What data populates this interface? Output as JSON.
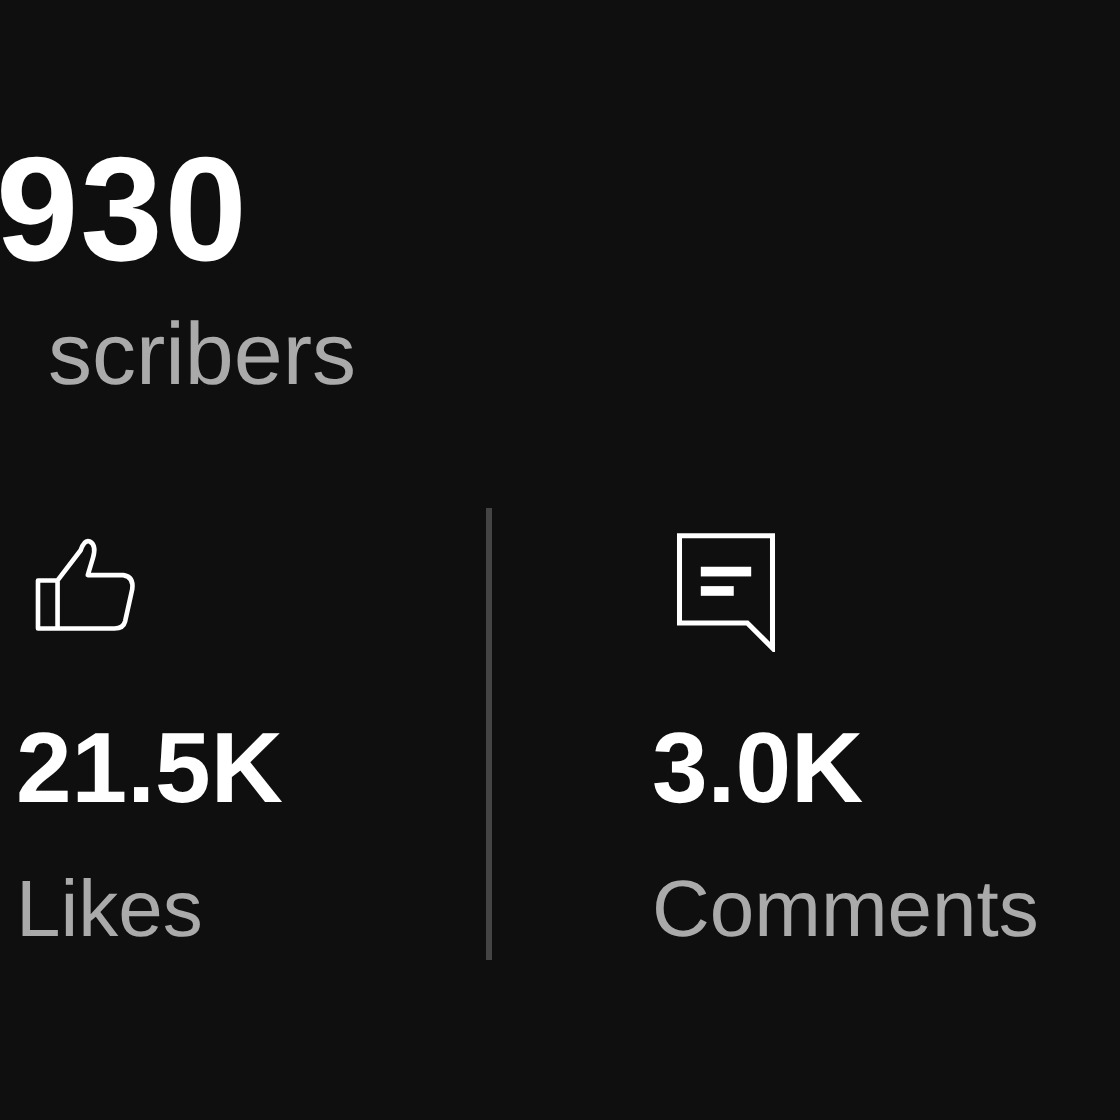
{
  "subscribers": {
    "value": "930",
    "label": "scribers"
  },
  "stats": [
    {
      "kind": "likes",
      "value": "21.5K",
      "label": "Likes"
    },
    {
      "kind": "comments",
      "value": "3.0K",
      "label": "Comments"
    }
  ]
}
